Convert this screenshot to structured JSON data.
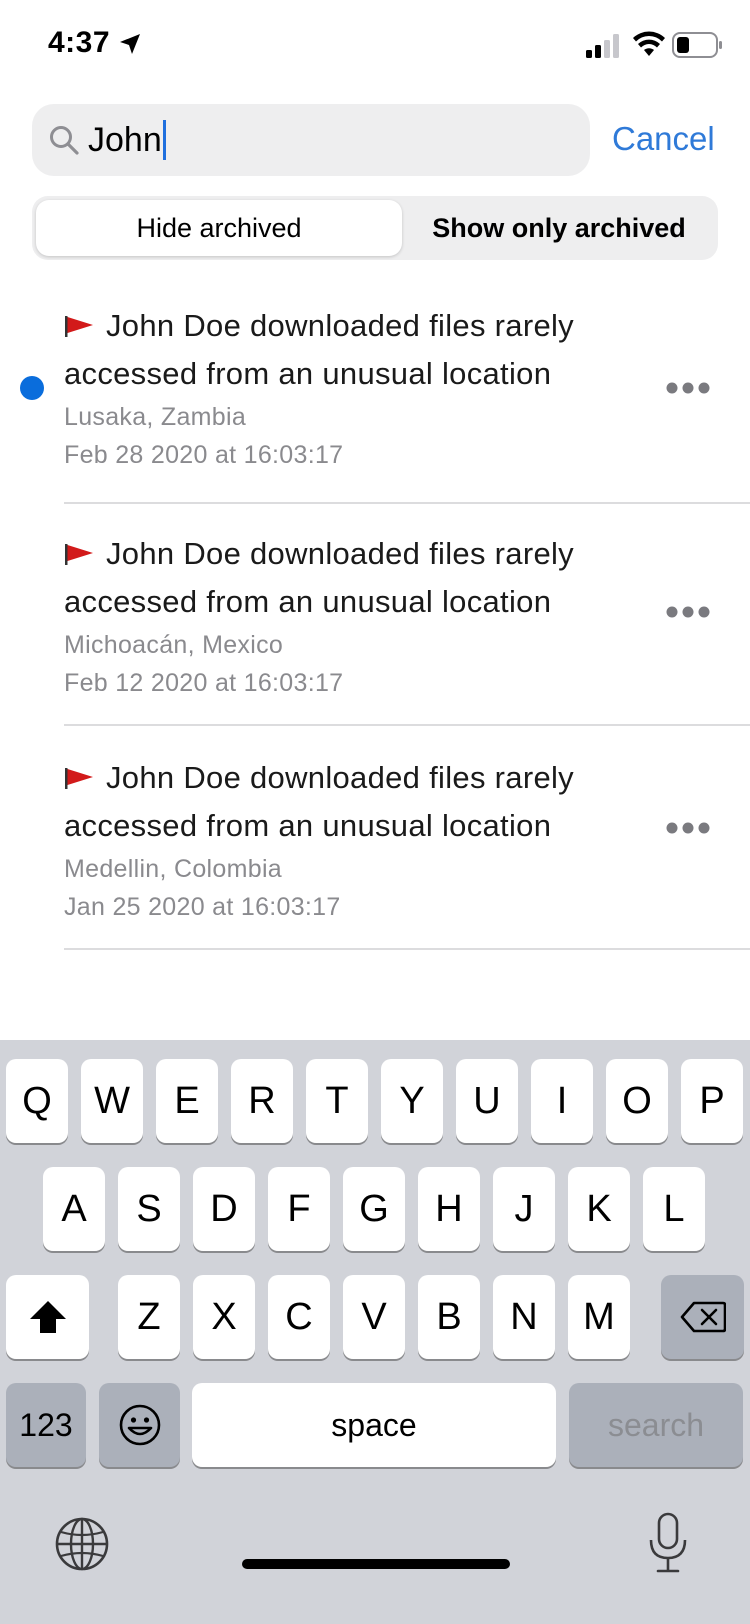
{
  "status_bar": {
    "time": "4:37"
  },
  "search": {
    "query": "John",
    "cancel_label": "Cancel"
  },
  "filter": {
    "options": [
      "Hide archived",
      "Show only archived"
    ],
    "selected": "Hide archived"
  },
  "alerts": [
    {
      "title": "John Doe downloaded files rarely accessed from an unusual location",
      "location": "Lusaka, Zambia",
      "timestamp": "Feb 28 2020 at 16:03:17",
      "unread": true
    },
    {
      "title": "John Doe downloaded files rarely accessed from an unusual location",
      "location": "Michoacán, Mexico",
      "timestamp": "Feb 12 2020 at 16:03:17",
      "unread": false
    },
    {
      "title": "John Doe downloaded files rarely accessed from an unusual location",
      "location": "Medellin, Colombia",
      "timestamp": "Jan 25 2020 at 16:03:17",
      "unread": false
    }
  ],
  "keyboard": {
    "row1": [
      "Q",
      "W",
      "E",
      "R",
      "T",
      "Y",
      "U",
      "I",
      "O",
      "P"
    ],
    "row2": [
      "A",
      "S",
      "D",
      "F",
      "G",
      "H",
      "J",
      "K",
      "L"
    ],
    "row3": [
      "Z",
      "X",
      "C",
      "V",
      "B",
      "N",
      "M"
    ],
    "numbers_key": "123",
    "space_key": "space",
    "return_key": "search"
  },
  "colors": {
    "accent": "#2f7ad8",
    "unread_dot": "#0a6ddc",
    "flag": "#d21a1a",
    "secondary_text": "#8a8a8e"
  }
}
